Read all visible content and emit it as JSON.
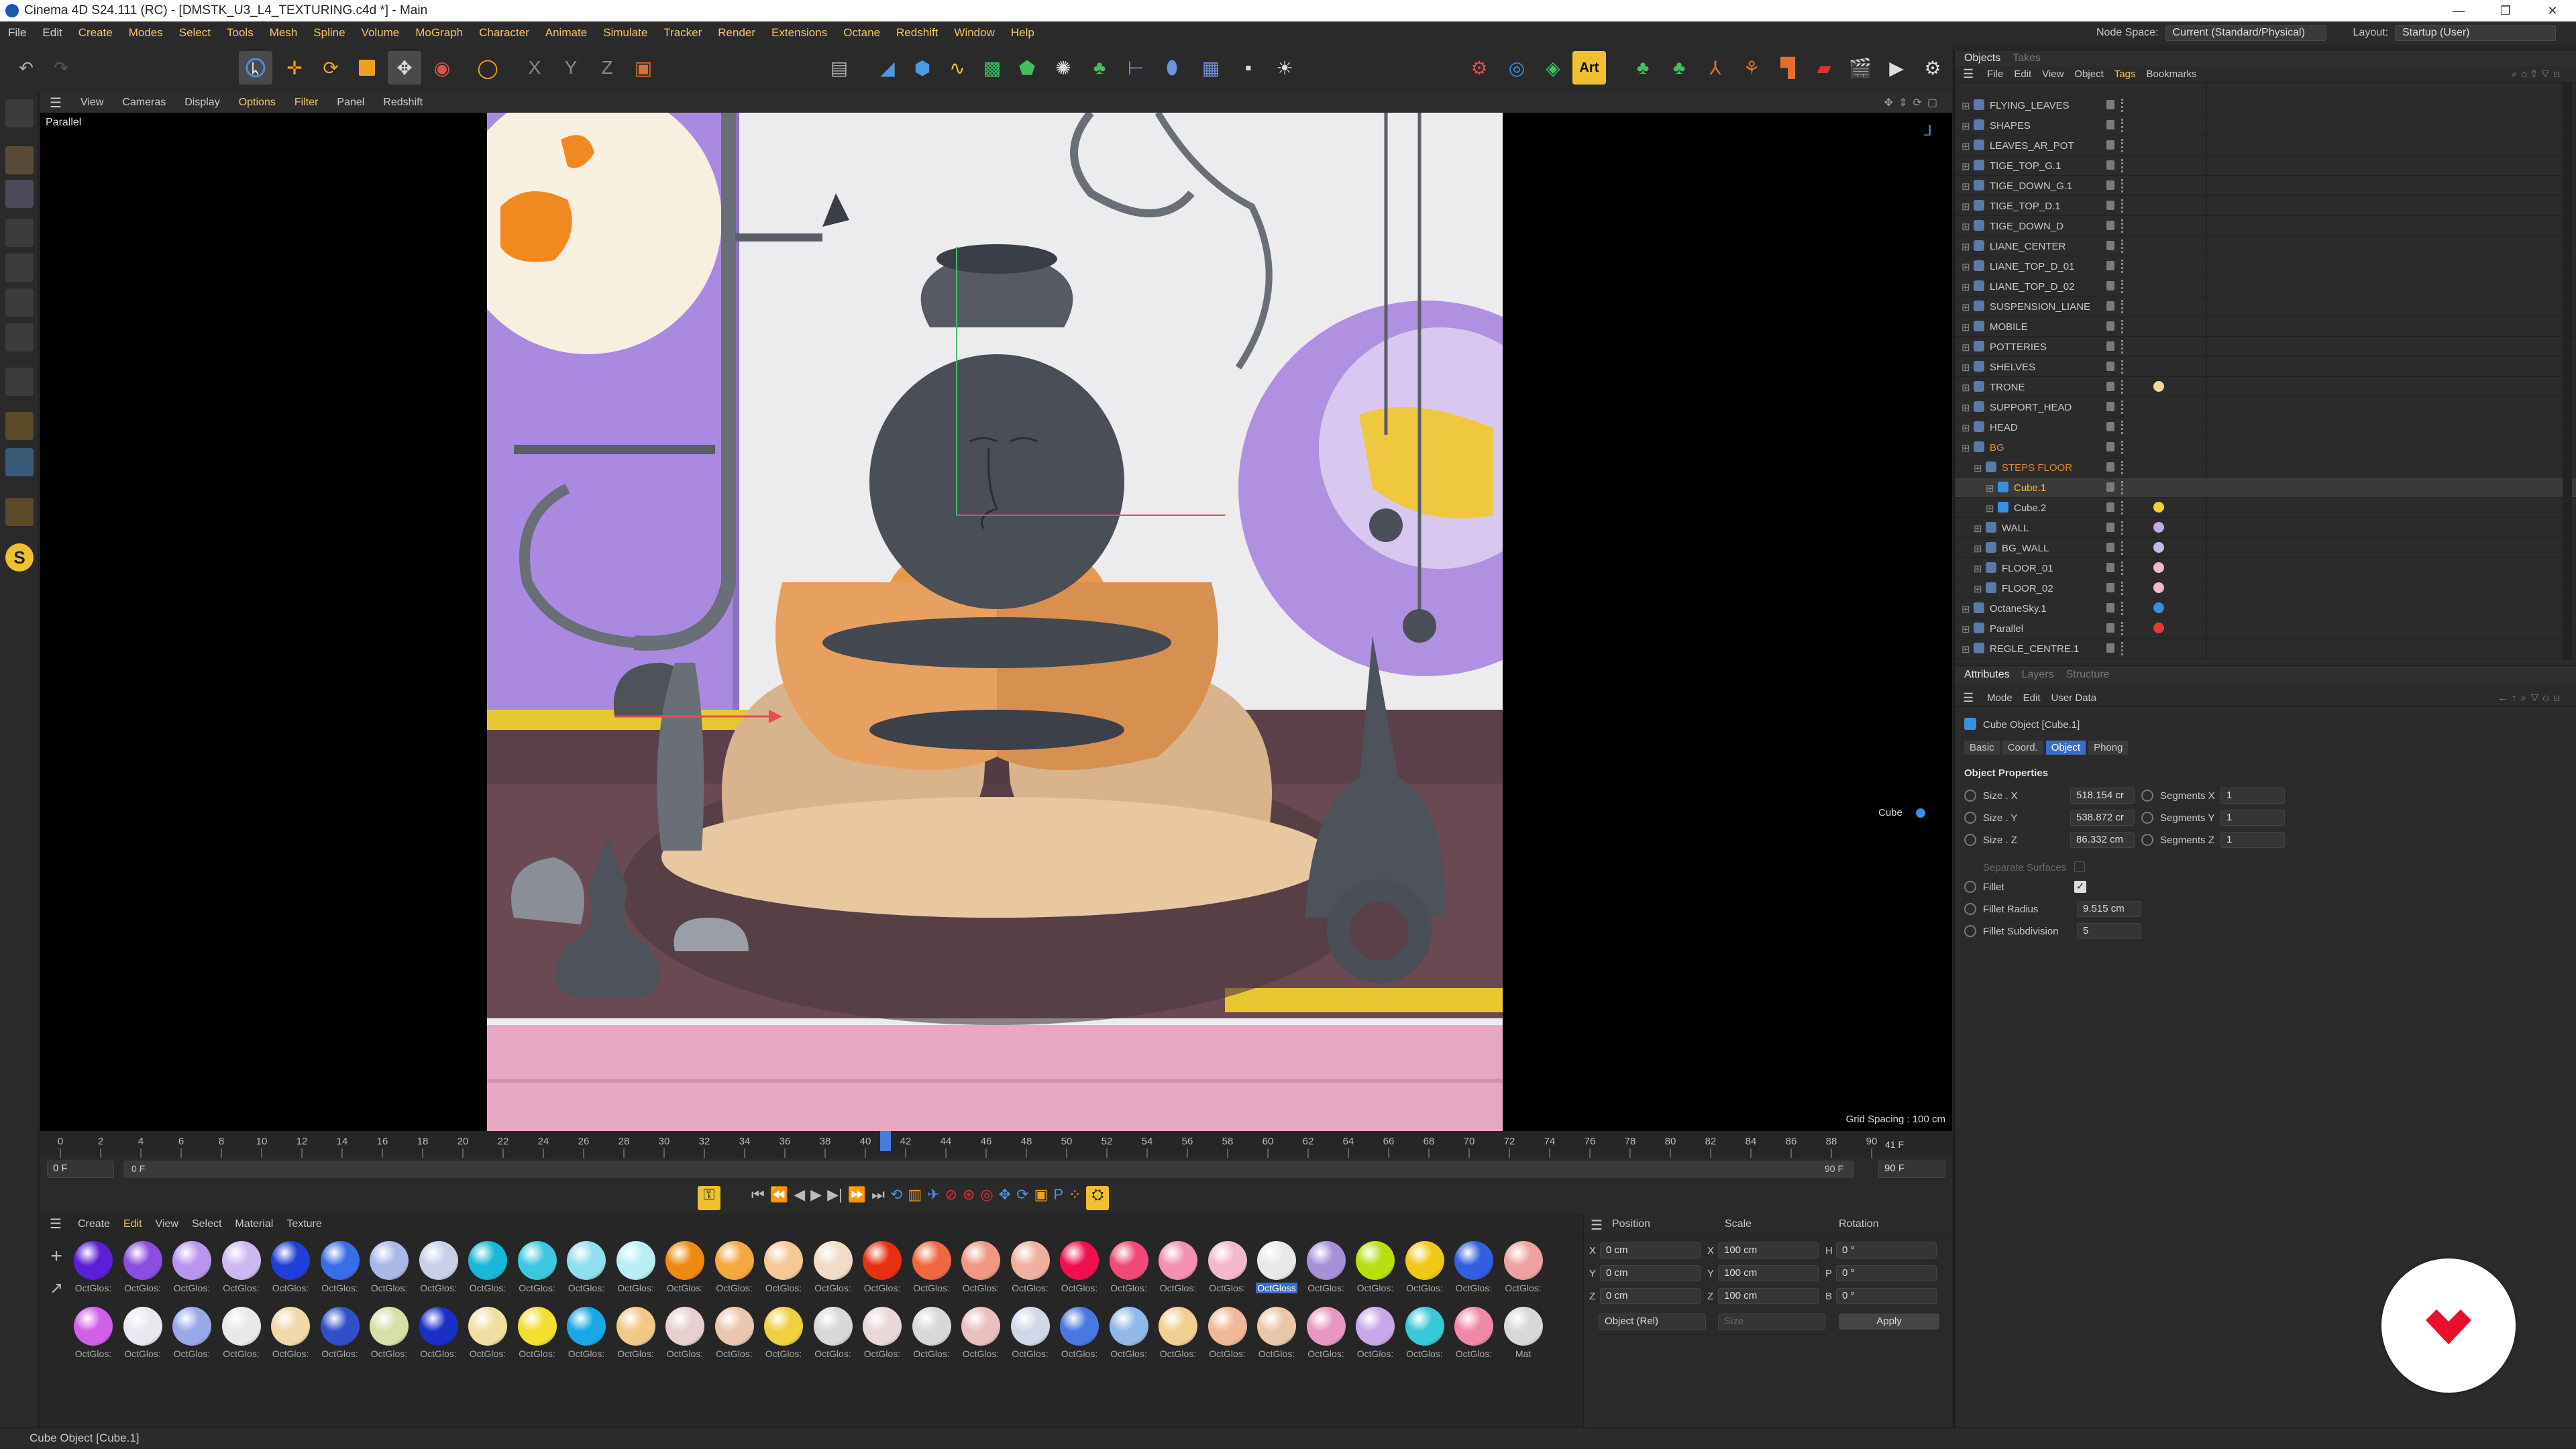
{
  "window": {
    "title": "Cinema 4D S24.111 (RC) - [DMSTK_U3_L4_TEXTURING.c4d *] - Main"
  },
  "menu": {
    "items": [
      "File",
      "Edit",
      "Create",
      "Modes",
      "Select",
      "Tools",
      "Mesh",
      "Spline",
      "Volume",
      "MoGraph",
      "Character",
      "Animate",
      "Simulate",
      "Tracker",
      "Render",
      "Extensions",
      "Octane",
      "Redshift",
      "Window",
      "Help"
    ],
    "node_space_label": "Node Space:",
    "node_space_value": "Current (Standard/Physical)",
    "layout_label": "Layout:",
    "layout_value": "Startup (User)"
  },
  "viewport": {
    "menu": [
      "View",
      "Cameras",
      "Display",
      "Options",
      "Filter",
      "Panel",
      "Redshift"
    ],
    "camera_label": "Parallel",
    "grid_spacing": "Grid Spacing : 100 cm",
    "object_label": "Cube"
  },
  "timeline": {
    "ticks": [
      "0",
      "2",
      "4",
      "6",
      "8",
      "10",
      "12",
      "14",
      "16",
      "18",
      "20",
      "22",
      "24",
      "26",
      "28",
      "30",
      "32",
      "34",
      "36",
      "38",
      "40",
      "42",
      "44",
      "46",
      "48",
      "50",
      "52",
      "54",
      "56",
      "58",
      "60",
      "62",
      "64",
      "66",
      "68",
      "70",
      "72",
      "74",
      "76",
      "78",
      "80",
      "82",
      "84",
      "86",
      "88",
      "90"
    ],
    "current_frame": "41 F",
    "start_field": "0 F",
    "range_start": "0 F",
    "range_end": "90 F",
    "end_field": "90 F",
    "current_frame_marker": 41
  },
  "material_manager": {
    "menu": [
      "Create",
      "Edit",
      "View",
      "Select",
      "Material",
      "Texture"
    ],
    "selected_label": "OctGloss",
    "default_label": "OctGlos:",
    "last_label": "Mat",
    "colors": [
      "#5a1fd6",
      "#8a4ee0",
      "#b896ee",
      "#cdb8f0",
      "#1f3fd8",
      "#3a6ee8",
      "#a8b8e8",
      "#c8d0e8",
      "#19b8d8",
      "#3ec8e0",
      "#8ee0ee",
      "#b8eef4",
      "#ef8a10",
      "#f5a840",
      "#f5c898",
      "#f0dcc8",
      "#e83010",
      "#f06840",
      "#f09880",
      "#f0b0a0",
      "#f01050",
      "#f04a78",
      "#f490b0",
      "#f4b8cc",
      "#e8e8e8",
      "#a890d8",
      "#b8e010",
      "#f0c818",
      "#3060e0",
      "#f0a0a0",
      "#d060e8",
      "#e8e8f0",
      "#98a8e8",
      "#e8e8e8",
      "#f0d8a8",
      "#3050c8",
      "#d8e0a8",
      "#1830c8",
      "#f0e0a0",
      "#f0e030",
      "#18a8e8",
      "#f0c888",
      "#e8d0d0",
      "#e8c8b0",
      "#f0d040",
      "#d8d8d8",
      "#e8d8d8",
      "#d8d8d8",
      "#e8c0c0",
      "#d0d8e8",
      "#4878e0",
      "#90b8e8",
      "#f0d090",
      "#f0b898",
      "#e8c8a8",
      "#e898c0",
      "#c8a8e8",
      "#38c8d8",
      "#f088a8",
      "#d8d8d8"
    ]
  },
  "coordinates": {
    "headers": [
      "Position",
      "Scale",
      "Rotation"
    ],
    "rows": [
      {
        "axis": "X",
        "pos": "0 cm",
        "saxis": "X",
        "scale": "100 cm",
        "raxis": "H",
        "rot": "0 °"
      },
      {
        "axis": "Y",
        "pos": "0 cm",
        "saxis": "Y",
        "scale": "100 cm",
        "raxis": "P",
        "rot": "0 °"
      },
      {
        "axis": "Z",
        "pos": "0 cm",
        "saxis": "Z",
        "scale": "100 cm",
        "raxis": "B",
        "rot": "0 °"
      }
    ],
    "mode": "Object (Rel)",
    "size_mode": "Size",
    "apply": "Apply"
  },
  "objects_panel": {
    "tabs": [
      "Objects",
      "Takes"
    ],
    "menu": [
      "File",
      "Edit",
      "View",
      "Object",
      "Tags",
      "Bookmarks"
    ],
    "rows": [
      {
        "name": "FLYING_LEAVES",
        "indent": 0,
        "color": "#c8c8c8"
      },
      {
        "name": "SHAPES",
        "indent": 0,
        "color": "#c8c8c8"
      },
      {
        "name": "LEAVES_AR_POT",
        "indent": 0,
        "color": "#c8c8c8"
      },
      {
        "name": "TIGE_TOP_G.1",
        "indent": 0,
        "color": "#c8c8c8"
      },
      {
        "name": "TIGE_DOWN_G.1",
        "indent": 0,
        "color": "#c8c8c8"
      },
      {
        "name": "TIGE_TOP_D.1",
        "indent": 0,
        "color": "#c8c8c8"
      },
      {
        "name": "TIGE_DOWN_D",
        "indent": 0,
        "color": "#c8c8c8"
      },
      {
        "name": "LIANE_CENTER",
        "indent": 0,
        "color": "#c8c8c8"
      },
      {
        "name": "LIANE_TOP_D_01",
        "indent": 0,
        "color": "#c8c8c8"
      },
      {
        "name": "LIANE_TOP_D_02",
        "indent": 0,
        "color": "#c8c8c8"
      },
      {
        "name": "SUSPENSION_LIANE",
        "indent": 0,
        "color": "#c8c8c8"
      },
      {
        "name": "MOBILE",
        "indent": 0,
        "color": "#c8c8c8"
      },
      {
        "name": "POTTERIES",
        "indent": 0,
        "color": "#c8c8c8"
      },
      {
        "name": "SHELVES",
        "indent": 0,
        "color": "#c8c8c8"
      },
      {
        "name": "TRONE",
        "indent": 0,
        "color": "#c8c8c8",
        "tag": "#f0d8a0"
      },
      {
        "name": "SUPPORT_HEAD",
        "indent": 0,
        "color": "#c8c8c8"
      },
      {
        "name": "HEAD",
        "indent": 0,
        "color": "#c8c8c8"
      },
      {
        "name": "BG",
        "indent": 0,
        "color": "#e08a3a"
      },
      {
        "name": "STEPS FLOOR",
        "indent": 1,
        "color": "#e08a3a"
      },
      {
        "name": "Cube.1",
        "indent": 2,
        "color": "#f0c030",
        "sel": true
      },
      {
        "name": "Cube.2",
        "indent": 2,
        "color": "#c8c8c8",
        "tag": "#f0d040"
      },
      {
        "name": "WALL",
        "indent": 1,
        "color": "#c8c8c8",
        "tag": "#c8a8e8"
      },
      {
        "name": "BG_WALL",
        "indent": 1,
        "color": "#c8c8c8",
        "tag": "#c8b8e8"
      },
      {
        "name": "FLOOR_01",
        "indent": 1,
        "color": "#c8c8c8",
        "tag": "#f0b8c8"
      },
      {
        "name": "FLOOR_02",
        "indent": 1,
        "color": "#c8c8c8",
        "tag": "#f0b8c8"
      },
      {
        "name": "OctaneSky.1",
        "indent": 0,
        "color": "#c8c8c8",
        "tag": "#3a90e0"
      },
      {
        "name": "Parallel",
        "indent": 0,
        "color": "#c8c8c8",
        "tag": "#e03a3a"
      },
      {
        "name": "REGLE_CENTRE.1",
        "indent": 0,
        "color": "#c8c8c8"
      }
    ]
  },
  "attributes_panel": {
    "tabs": [
      "Attributes",
      "Layers",
      "Structure"
    ],
    "menu": [
      "Mode",
      "Edit",
      "User Data"
    ],
    "object_title": "Cube Object [Cube.1]",
    "subtabs": [
      "Basic",
      "Coord.",
      "Object",
      "Phong"
    ],
    "section": "Object Properties",
    "size_x_label": "Size . X",
    "size_x": "518.154 cr",
    "size_y_label": "Size . Y",
    "size_y": "538.872 cr",
    "size_z_label": "Size . Z",
    "size_z": "86.332 cm",
    "seg_x_label": "Segments X",
    "seg_x": "1",
    "seg_y_label": "Segments Y",
    "seg_y": "1",
    "seg_z_label": "Segments Z",
    "seg_z": "1",
    "separate_surfaces": "Separate Surfaces",
    "fillet": "Fillet",
    "fillet_radius_label": "Fillet Radius",
    "fillet_radius": "9.515 cm",
    "fillet_subdivision_label": "Fillet Subdivision",
    "fillet_subdivision": "5"
  },
  "status_bar": {
    "text": "Cube Object [Cube.1]"
  }
}
